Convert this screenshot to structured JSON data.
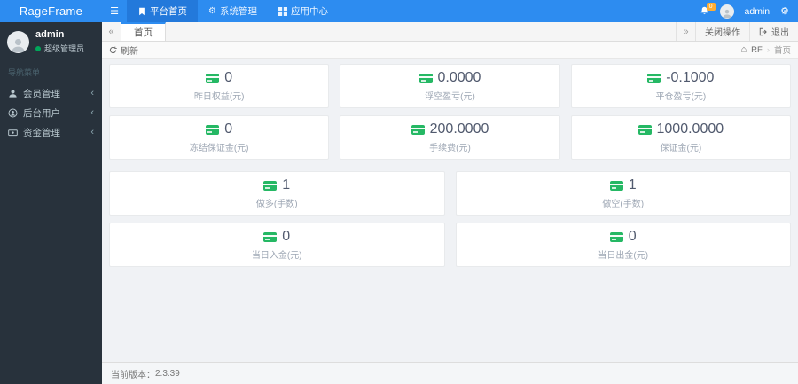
{
  "brand": {
    "name": "RageFrame"
  },
  "topnav": {
    "items": [
      {
        "label": "平台首页"
      },
      {
        "label": "系统管理"
      },
      {
        "label": "应用中心"
      }
    ]
  },
  "userbar": {
    "notification_count": "0",
    "username": "admin"
  },
  "sidebar": {
    "user": {
      "name": "admin",
      "role": "超级管理员"
    },
    "section_title": "导航菜单",
    "items": [
      {
        "label": "会员管理"
      },
      {
        "label": "后台用户"
      },
      {
        "label": "资金管理"
      }
    ]
  },
  "tabs": {
    "active_tab": "首页",
    "close_actions_label": "关闭操作",
    "logout_label": "退出"
  },
  "toolbar": {
    "refresh_label": "刷新",
    "breadcrumb": {
      "root": "RF",
      "current": "首页"
    }
  },
  "stats": {
    "row1": [
      {
        "value": "0",
        "label": "昨日权益(元)"
      },
      {
        "value": "0.0000",
        "label": "浮空盈亏(元)"
      },
      {
        "value": "-0.1000",
        "label": "平仓盈亏(元)"
      }
    ],
    "row2": [
      {
        "value": "0",
        "label": "冻结保证金(元)"
      },
      {
        "value": "200.0000",
        "label": "手续费(元)"
      },
      {
        "value": "1000.0000",
        "label": "保证金(元)"
      }
    ],
    "row3": [
      {
        "value": "1",
        "label": "做多(手数)"
      },
      {
        "value": "1",
        "label": "做空(手数)"
      }
    ],
    "row4": [
      {
        "value": "0",
        "label": "当日入金(元)"
      },
      {
        "value": "0",
        "label": "当日出金(元)"
      }
    ]
  },
  "footer": {
    "version_label": "当前版本：",
    "version": "2.3.39"
  },
  "colors": {
    "topbar": "#2d8cf0",
    "sidebar": "#28323c",
    "card_icon_green": "#25b864",
    "badge_orange": "#ffad33"
  }
}
